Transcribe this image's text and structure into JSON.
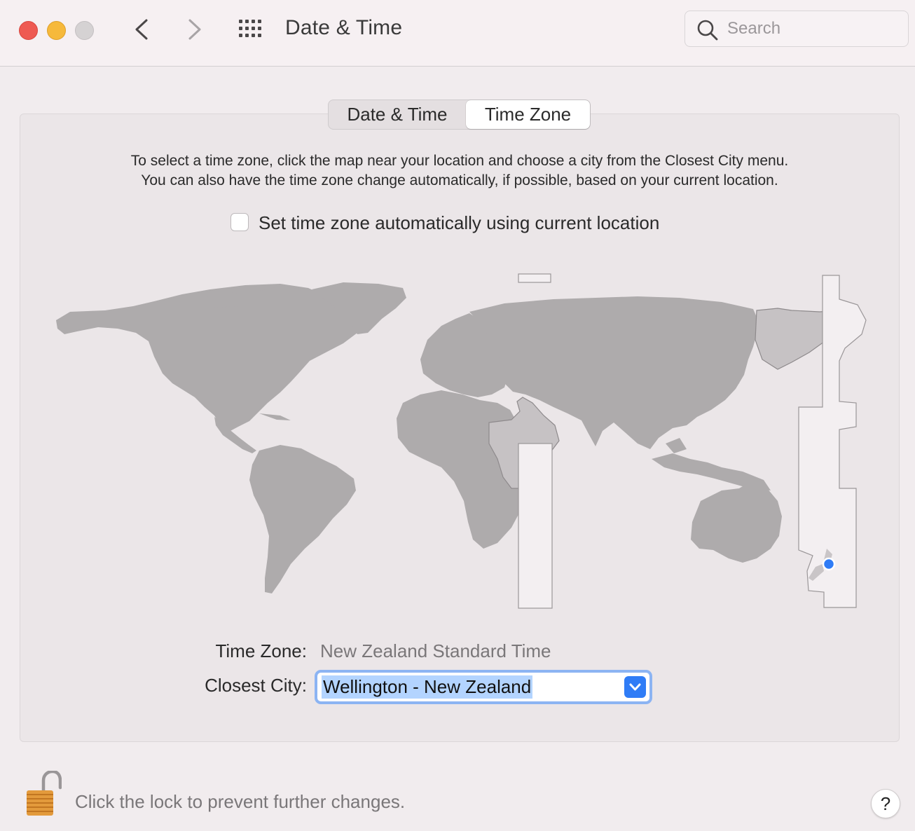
{
  "window": {
    "title": "Date & Time"
  },
  "search": {
    "placeholder": "Search"
  },
  "tabs": [
    {
      "label": "Date & Time",
      "selected": false
    },
    {
      "label": "Time Zone",
      "selected": true
    }
  ],
  "instructions": {
    "line1": "To select a time zone, click the map near your location and choose a city from the Closest City menu.",
    "line2": "You can also have the time zone change automatically, if possible, based on your current location."
  },
  "auto_timezone": {
    "label": "Set time zone automatically using current location",
    "checked": false
  },
  "time_zone": {
    "label": "Time Zone:",
    "value": "New Zealand Standard Time"
  },
  "closest_city": {
    "label": "Closest City:",
    "value": "Wellington - New Zealand"
  },
  "lock": {
    "text": "Click the lock to prevent further changes."
  },
  "help": {
    "label": "?"
  },
  "colors": {
    "land": "#aeabac",
    "selected_zone": "#f3eff1",
    "location_pin": "#2f7cf6",
    "accent": "#2f7cf6"
  }
}
